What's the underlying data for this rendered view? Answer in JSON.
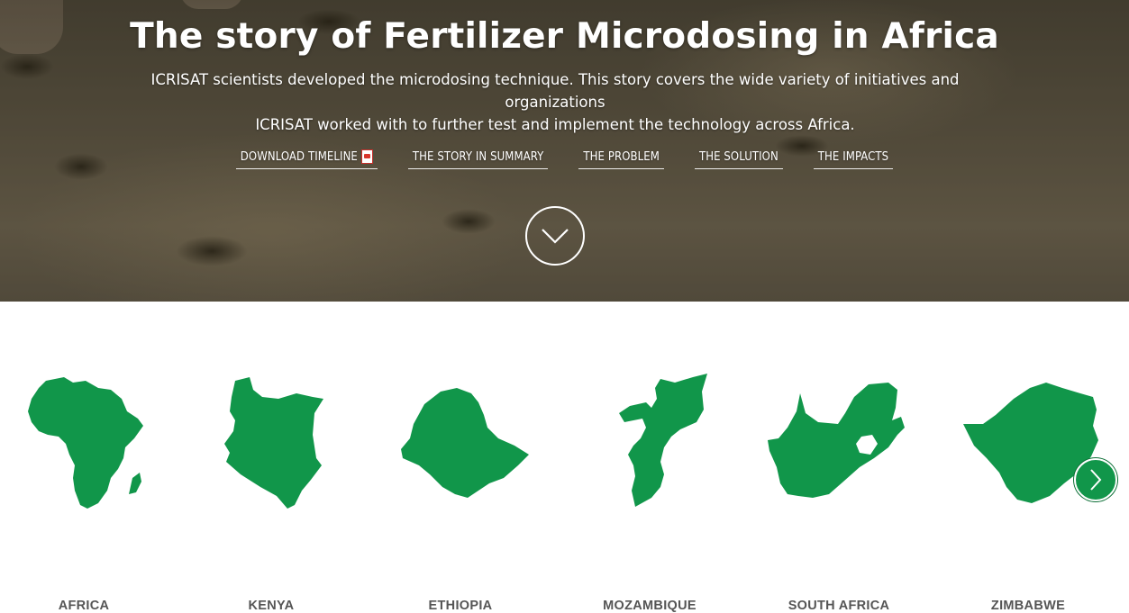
{
  "hero": {
    "title": "The story of Fertilizer Microdosing in Africa",
    "subtitle_line1": "ICRISAT scientists developed the microdosing technique. This story covers the wide variety of initiatives and organizations",
    "subtitle_line2": "ICRISAT worked with to further test and implement the technology across Africa.",
    "nav": [
      {
        "label": "DOWNLOAD TIMELINE",
        "icon": "pdf-icon"
      },
      {
        "label": "THE STORY IN SUMMARY"
      },
      {
        "label": "THE PROBLEM"
      },
      {
        "label": "THE SOLUTION"
      },
      {
        "label": "THE IMPACTS"
      }
    ],
    "scroll_icon": "chevron-down-icon"
  },
  "countries": [
    {
      "name": "AFRICA"
    },
    {
      "name": "KENYA"
    },
    {
      "name": "ETHIOPIA"
    },
    {
      "name": "MOZAMBIQUE"
    },
    {
      "name": "SOUTH AFRICA"
    },
    {
      "name": "ZIMBABWE"
    }
  ],
  "carousel": {
    "next_icon": "chevron-right-icon"
  },
  "colors": {
    "map_green": "#11964a",
    "label_gray": "#555555",
    "hero_text": "#ffffff"
  }
}
